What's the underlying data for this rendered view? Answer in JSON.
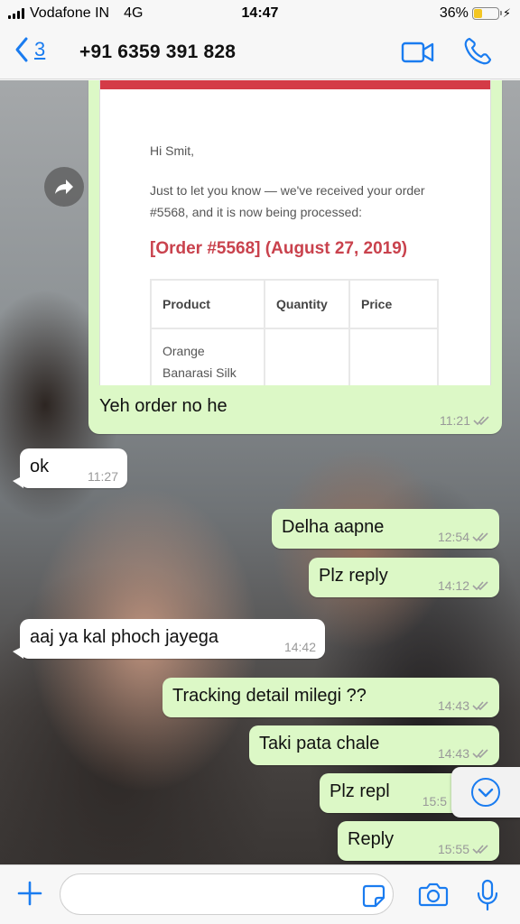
{
  "status_bar": {
    "carrier": "Vodafone IN",
    "network": "4G",
    "time": "14:47",
    "battery_percent": "36%",
    "battery_level": 0.36
  },
  "header": {
    "back_count": "3",
    "contact": "+91 6359 391 828",
    "accent_color": "#1a7cf0"
  },
  "image_message": {
    "greeting": "Hi Smit,",
    "body": "Just to let you know — we've received your order #5568, and it is now being processed:",
    "order_heading": "[Order #5568] (August 27, 2019)",
    "table_headers": [
      "Product",
      "Quantity",
      "Price"
    ],
    "table_rows": [
      [
        "Orange Banarasi Silk",
        "",
        ""
      ]
    ],
    "caption": "Yeh order no he",
    "time": "11:21"
  },
  "messages": [
    {
      "dir": "in",
      "text": "ok",
      "time": "11:27"
    },
    {
      "dir": "out",
      "text": "Delha aapne",
      "time": "12:54"
    },
    {
      "dir": "out",
      "text": "Plz reply",
      "time": "14:12"
    },
    {
      "dir": "in",
      "text": "aaj ya kal phoch jayega",
      "time": "14:42"
    },
    {
      "dir": "out",
      "text": "Tracking detail milegi ??",
      "time": "14:43"
    },
    {
      "dir": "out",
      "text": "Taki pata chale",
      "time": "14:43"
    },
    {
      "dir": "out",
      "text": "Plz repl",
      "time": "15:5"
    },
    {
      "dir": "out",
      "text": "Reply",
      "time": "15:55"
    }
  ],
  "input": {
    "placeholder": ""
  }
}
